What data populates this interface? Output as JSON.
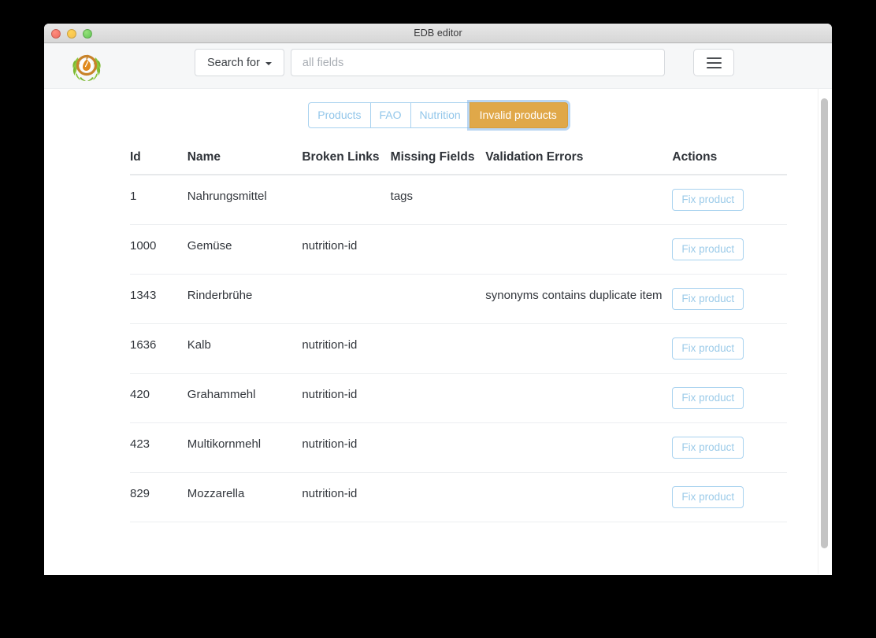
{
  "window": {
    "title": "EDB editor",
    "traffic_lights": [
      "close",
      "minimize",
      "maximize"
    ]
  },
  "header": {
    "logo_alt": "app-logo",
    "search_for_label": "Search for",
    "search_placeholder": "all fields",
    "search_value": "",
    "menu_icon": "hamburger-icon"
  },
  "tabs": [
    {
      "label": "Products",
      "active": false
    },
    {
      "label": "FAO",
      "active": false
    },
    {
      "label": "Nutrition",
      "active": false
    },
    {
      "label": "Invalid products",
      "active": true
    }
  ],
  "table": {
    "columns": [
      "Id",
      "Name",
      "Broken Links",
      "Missing Fields",
      "Validation Errors",
      "Actions"
    ],
    "action_label": "Fix product",
    "rows": [
      {
        "id": "1",
        "name": "Nahrungsmittel",
        "broken_links": "",
        "missing_fields": "tags",
        "validation_errors": ""
      },
      {
        "id": "1000",
        "name": "Gemüse",
        "broken_links": "nutrition-id",
        "missing_fields": "",
        "validation_errors": ""
      },
      {
        "id": "1343",
        "name": "Rinderbrühe",
        "broken_links": "",
        "missing_fields": "",
        "validation_errors": "synonyms contains duplicate item"
      },
      {
        "id": "1636",
        "name": "Kalb",
        "broken_links": "nutrition-id",
        "missing_fields": "",
        "validation_errors": ""
      },
      {
        "id": "420",
        "name": "Grahammehl",
        "broken_links": "nutrition-id",
        "missing_fields": "",
        "validation_errors": ""
      },
      {
        "id": "423",
        "name": "Multikornmehl",
        "broken_links": "nutrition-id",
        "missing_fields": "",
        "validation_errors": ""
      },
      {
        "id": "829",
        "name": "Mozzarella",
        "broken_links": "nutrition-id",
        "missing_fields": "",
        "validation_errors": ""
      }
    ]
  },
  "colors": {
    "active_tab_bg": "#e0a849",
    "tab_border": "#a8d2ef",
    "tab_text": "#92c6ea",
    "header_bg": "#f6f7f8",
    "focus_ring": "#82b4e8"
  },
  "scrollbar": {
    "orientation": "vertical"
  }
}
